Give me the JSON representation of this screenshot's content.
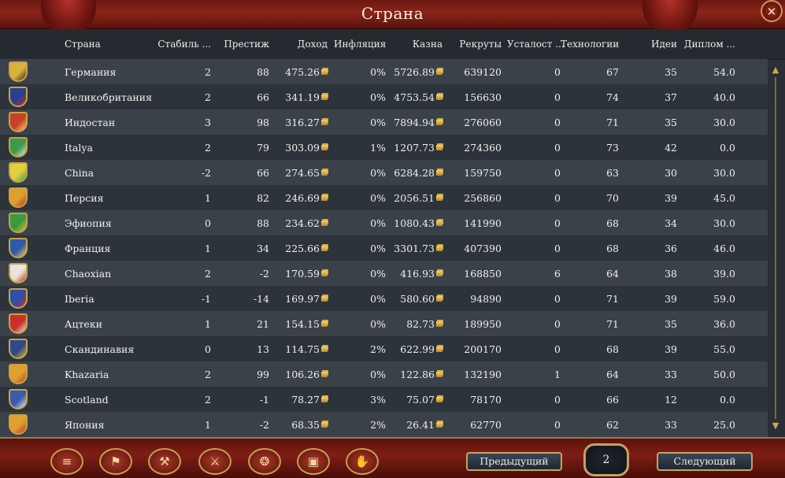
{
  "window": {
    "title": "Страна"
  },
  "columns": {
    "country": "Страна",
    "stability": "Стабиль ...",
    "prestige": "Престиж",
    "income": "Доход",
    "inflation": "Инфляция",
    "treasury": "Казна",
    "manpower": "Рекруты",
    "weariness": "Усталост ...",
    "tech": "Технологии",
    "ideas": "Идеи",
    "diplomacy": "Диплом ..."
  },
  "rows": [
    {
      "country": "Германия",
      "stability": "2",
      "prestige": "88",
      "income": "475.26",
      "inflation": "0%",
      "treasury": "5726.89",
      "manpower": "639120",
      "weariness": "0",
      "tech": "67",
      "ideas": "35",
      "diplomacy": "54.0",
      "flag_color": "#d8b23a",
      "flag_accent": "#2a2a2a",
      "flag_icon": "eagle-icon"
    },
    {
      "country": "Великобритания",
      "stability": "2",
      "prestige": "66",
      "income": "341.19",
      "inflation": "0%",
      "treasury": "4753.54",
      "manpower": "156630",
      "weariness": "0",
      "tech": "74",
      "ideas": "37",
      "diplomacy": "40.0",
      "flag_color": "#2a3f8f",
      "flag_accent": "#c92a2a",
      "flag_icon": "union-jack-icon"
    },
    {
      "country": "Индостан",
      "stability": "3",
      "prestige": "98",
      "income": "316.27",
      "inflation": "0%",
      "treasury": "7894.94",
      "manpower": "276060",
      "weariness": "0",
      "tech": "71",
      "ideas": "35",
      "diplomacy": "30.0",
      "flag_color": "#c9402a",
      "flag_accent": "#f0d060",
      "flag_icon": "crest-icon"
    },
    {
      "country": "Italya",
      "stability": "2",
      "prestige": "79",
      "income": "303.09",
      "inflation": "1%",
      "treasury": "1207.73",
      "manpower": "274360",
      "weariness": "0",
      "tech": "73",
      "ideas": "42",
      "diplomacy": "0.0",
      "flag_color": "#3e9a4a",
      "flag_accent": "#e8e8e8",
      "flag_icon": "stripes-icon"
    },
    {
      "country": "China",
      "stability": "-2",
      "prestige": "66",
      "income": "274.65",
      "inflation": "0%",
      "treasury": "6284.28",
      "manpower": "159750",
      "weariness": "0",
      "tech": "63",
      "ideas": "30",
      "diplomacy": "30.0",
      "flag_color": "#e0d040",
      "flag_accent": "#3aa050",
      "flag_icon": "stripes-icon"
    },
    {
      "country": "Персия",
      "stability": "1",
      "prestige": "82",
      "income": "246.69",
      "inflation": "0%",
      "treasury": "2056.51",
      "manpower": "256860",
      "weariness": "0",
      "tech": "70",
      "ideas": "39",
      "diplomacy": "45.0",
      "flag_color": "#e0a030",
      "flag_accent": "#c0302a",
      "flag_icon": "cross-icon"
    },
    {
      "country": "Эфиопия",
      "stability": "0",
      "prestige": "88",
      "income": "234.62",
      "inflation": "0%",
      "treasury": "1080.43",
      "manpower": "141990",
      "weariness": "0",
      "tech": "68",
      "ideas": "34",
      "diplomacy": "30.0",
      "flag_color": "#3a9a40",
      "flag_accent": "#d8c030",
      "flag_icon": "lion-icon"
    },
    {
      "country": "Франция",
      "stability": "1",
      "prestige": "34",
      "income": "225.66",
      "inflation": "0%",
      "treasury": "3301.73",
      "manpower": "407390",
      "weariness": "0",
      "tech": "68",
      "ideas": "36",
      "diplomacy": "46.0",
      "flag_color": "#2f5aa8",
      "flag_accent": "#e8d060",
      "flag_icon": "lily-icon"
    },
    {
      "country": "Chaoxian",
      "stability": "2",
      "prestige": "-2",
      "income": "170.59",
      "inflation": "0%",
      "treasury": "416.93",
      "manpower": "168850",
      "weariness": "6",
      "tech": "64",
      "ideas": "38",
      "diplomacy": "39.0",
      "flag_color": "#e8e4dc",
      "flag_accent": "#c82a2a",
      "flag_icon": "circle-icon"
    },
    {
      "country": "Iberia",
      "stability": "-1",
      "prestige": "-14",
      "income": "169.97",
      "inflation": "0%",
      "treasury": "580.60",
      "manpower": "94890",
      "weariness": "0",
      "tech": "71",
      "ideas": "39",
      "diplomacy": "59.0",
      "flag_color": "#2f4fa8",
      "flag_accent": "#d82a2a",
      "flag_icon": "quarters-icon"
    },
    {
      "country": "Ацтеки",
      "stability": "1",
      "prestige": "21",
      "income": "154.15",
      "inflation": "0%",
      "treasury": "82.73",
      "manpower": "189950",
      "weariness": "0",
      "tech": "71",
      "ideas": "35",
      "diplomacy": "36.0",
      "flag_color": "#c8302a",
      "flag_accent": "#e8e0d0",
      "flag_icon": "sun-icon"
    },
    {
      "country": "Скандинавия",
      "stability": "0",
      "prestige": "13",
      "income": "114.75",
      "inflation": "2%",
      "treasury": "622.99",
      "manpower": "200170",
      "weariness": "0",
      "tech": "68",
      "ideas": "39",
      "diplomacy": "55.0",
      "flag_color": "#2f4a8a",
      "flag_accent": "#d8b040",
      "flag_icon": "crown-icon"
    },
    {
      "country": "Khazaria",
      "stability": "2",
      "prestige": "99",
      "income": "106.26",
      "inflation": "0%",
      "treasury": "122.86",
      "manpower": "132190",
      "weariness": "1",
      "tech": "64",
      "ideas": "33",
      "diplomacy": "50.0",
      "flag_color": "#e0a030",
      "flag_accent": "#c0402a",
      "flag_icon": "grid-icon"
    },
    {
      "country": "Scotland",
      "stability": "2",
      "prestige": "-1",
      "income": "78.27",
      "inflation": "3%",
      "treasury": "75.07",
      "manpower": "78170",
      "weariness": "0",
      "tech": "66",
      "ideas": "12",
      "diplomacy": "0.0",
      "flag_color": "#3a5ab0",
      "flag_accent": "#e8e8e8",
      "flag_icon": "saltire-icon"
    },
    {
      "country": "Япония",
      "stability": "1",
      "prestige": "-2",
      "income": "68.35",
      "inflation": "2%",
      "treasury": "26.41",
      "manpower": "62770",
      "weariness": "0",
      "tech": "62",
      "ideas": "33",
      "diplomacy": "25.0",
      "flag_color": "#e0a030",
      "flag_accent": "#c8302a",
      "flag_icon": "circle-icon"
    }
  ],
  "toolbar": {
    "icons": [
      "ledger-icon",
      "flag-icon",
      "army-icon",
      "swords-icon",
      "coins-icon",
      "trade-icon",
      "handshake-icon"
    ],
    "glyphs": [
      "≡",
      "⚑",
      "⚒",
      "⚔",
      "❂",
      "▣",
      "✋"
    ]
  },
  "pagination": {
    "prev_label": "Предыдущий",
    "next_label": "Следующий",
    "page": "2"
  },
  "close_glyph": "✕",
  "scroll": {
    "up": "▲",
    "down": "▼"
  },
  "colors": {
    "accent_gold": "#c4a262",
    "title_red": "#8a2418",
    "row_odd": "#3a4149",
    "row_even": "#2d333a"
  }
}
